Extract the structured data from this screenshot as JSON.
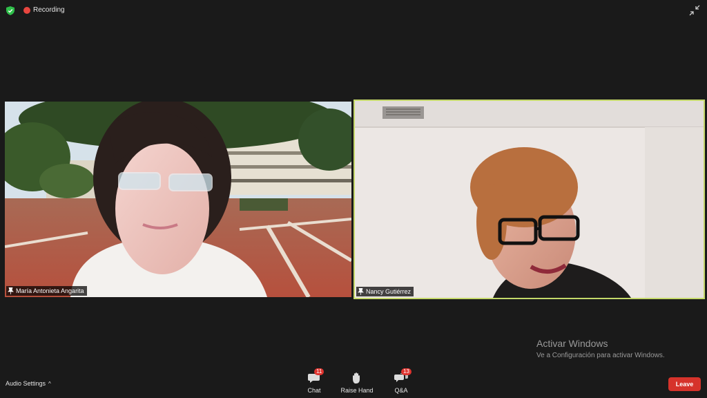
{
  "top_bar": {
    "recording_label": "Recording",
    "icons": {
      "security": "shield-check-icon",
      "minimize": "minimize-icon"
    }
  },
  "participants": [
    {
      "name": "María Antonieta Angarita",
      "icon": "pin-icon"
    },
    {
      "name": "Nancy Gutiérrez",
      "icon": "pin-icon",
      "active_speaker": true
    }
  ],
  "watermark": {
    "title": "Activar Windows",
    "subtitle": "Ve a Configuración para activar Windows."
  },
  "bottom_bar": {
    "audio_settings": {
      "label": "Audio Settings",
      "caret": "^"
    },
    "chat": {
      "label": "Chat",
      "badge": "11",
      "icon": "chat-icon"
    },
    "raise_hand": {
      "label": "Raise Hand",
      "icon": "hand-icon"
    },
    "qa": {
      "label": "Q&A",
      "badge": "13",
      "icon": "qa-icon"
    },
    "leave": {
      "label": "Leave"
    }
  },
  "colors": {
    "background": "#1a1a1a",
    "recording_red": "#e8463f",
    "active_speaker_border": "#c5d96a",
    "leave_red": "#d6332b",
    "badge_red": "#e0342f",
    "security_green": "#2fbf4a"
  }
}
